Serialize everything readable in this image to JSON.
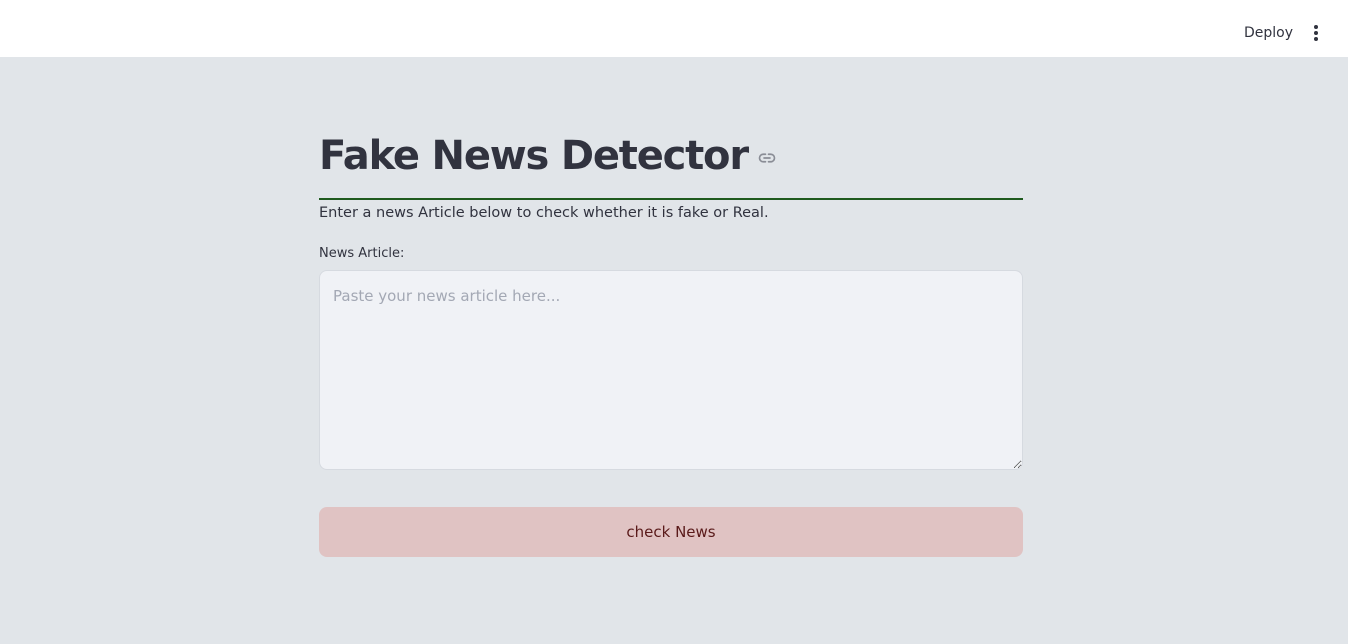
{
  "header": {
    "deploy_label": "Deploy",
    "menu_icon": "vertical-ellipsis-icon"
  },
  "main": {
    "title": "Fake News Detector",
    "title_icon": "link-icon",
    "subtitle": "Enter a news Article below to check whether it is fake or Real.",
    "article_field": {
      "label": "News Article:",
      "placeholder": "Paste your news article here...",
      "value": ""
    },
    "check_button_label": "check News"
  },
  "colors": {
    "page_background": "#e1e5e9",
    "header_background": "#ffffff",
    "divider": "#1e5a1e",
    "input_background": "#f0f2f6",
    "button_background": "#e0c3c3",
    "button_text": "#5a1a1a",
    "text": "#31333f"
  }
}
